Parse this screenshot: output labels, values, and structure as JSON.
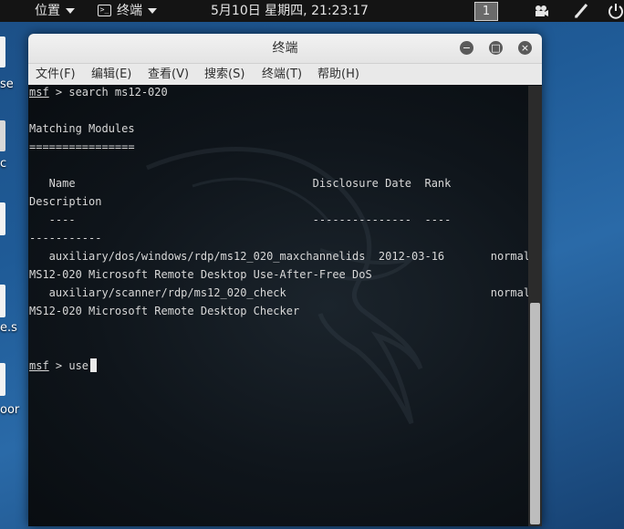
{
  "topbar": {
    "places": "位置",
    "app": "终端",
    "clock": "5月10日 星期四, 21:23:17",
    "workspace": "1"
  },
  "desktop": {
    "labels": [
      "se",
      "c",
      "e.s",
      "oor"
    ]
  },
  "window": {
    "title": "终端",
    "buttons": {
      "minimize": "−",
      "maximize": "□",
      "close": "×"
    },
    "menu": [
      "文件(F)",
      "编辑(E)",
      "查看(V)",
      "搜索(S)",
      "终端(T)",
      "帮助(H)"
    ]
  },
  "terminal": {
    "prompt": "msf",
    "command1": " > search ms12-020",
    "matching": "Matching Modules",
    "rule": "================",
    "header": "   Name                                    Disclosure Date  Rank",
    "header2": "Description",
    "dashes": "   ----                                    ---------------  ----",
    "dashes2": "-----------",
    "rows": [
      {
        "line": "   auxiliary/dos/windows/rdp/ms12_020_maxchannelids  2012-03-16       normal",
        "desc": "MS12-020 Microsoft Remote Desktop Use-After-Free DoS"
      },
      {
        "line": "   auxiliary/scanner/rdp/ms12_020_check                               normal",
        "desc": "MS12-020 Microsoft Remote Desktop Checker"
      }
    ],
    "command2": " > use"
  }
}
